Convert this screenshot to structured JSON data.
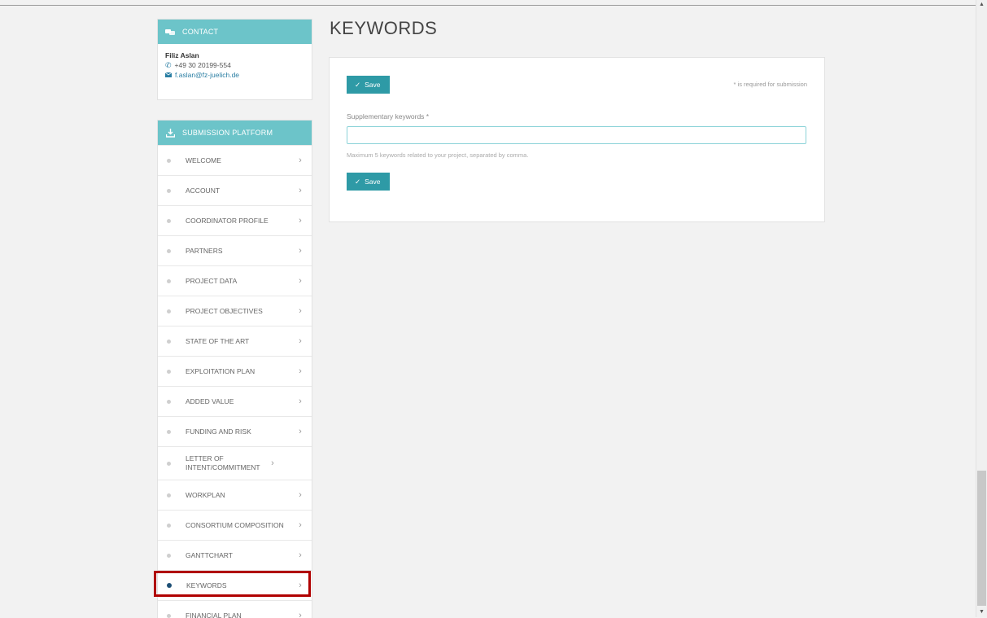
{
  "contact": {
    "header": "CONTACT",
    "name": "Filiz Aslan",
    "phone": "+49 30 20199-554",
    "email": "f.aslan@fz-juelich.de"
  },
  "submission": {
    "header": "SUBMISSION PLATFORM",
    "items": [
      {
        "label": "WELCOME"
      },
      {
        "label": "ACCOUNT"
      },
      {
        "label": "COORDINATOR PROFILE"
      },
      {
        "label": "PARTNERS"
      },
      {
        "label": "PROJECT DATA"
      },
      {
        "label": "PROJECT OBJECTIVES"
      },
      {
        "label": "STATE OF THE ART"
      },
      {
        "label": "EXPLOITATION PLAN"
      },
      {
        "label": "ADDED VALUE"
      },
      {
        "label": "FUNDING AND RISK"
      },
      {
        "label": "LETTER OF INTENT/COMMITMENT"
      },
      {
        "label": "WORKPLAN"
      },
      {
        "label": "CONSORTIUM COMPOSITION"
      },
      {
        "label": "GANTTCHART"
      },
      {
        "label": "KEYWORDS",
        "active": true
      },
      {
        "label": "FINANCIAL PLAN"
      }
    ]
  },
  "main": {
    "title": "KEYWORDS",
    "save_label": "Save",
    "required_note": "* is required for submission",
    "field_label": "Supplementary keywords *",
    "field_value": "",
    "field_help": "Maximum 5 keywords related to your project, separated by comma."
  },
  "colors": {
    "header_bg": "#6cc4c9",
    "button_bg": "#2e9aa6",
    "active_dot": "#1d4f75",
    "highlight": "#b00000"
  }
}
